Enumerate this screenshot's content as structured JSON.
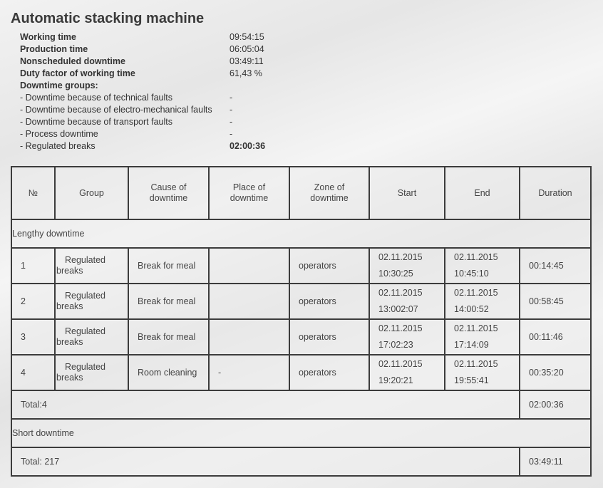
{
  "title": "Automatic stacking machine",
  "summary": {
    "working_time_label": "Working time",
    "working_time_value": "09:54:15",
    "production_time_label": "Production time",
    "production_time_value": "06:05:04",
    "nonscheduled_label": "Nonscheduled downtime",
    "nonscheduled_value": "03:49:11",
    "duty_factor_label": "Duty factor of working time",
    "duty_factor_value": "61,43 %",
    "groups_label": "Downtime groups:",
    "groups": [
      {
        "label": "- Downtime because of technical faults",
        "value": "-"
      },
      {
        "label": "- Downtime because of electro-mechanical faults",
        "value": "-"
      },
      {
        "label": "- Downtime because of transport faults",
        "value": "-"
      },
      {
        "label": "- Process downtime",
        "value": "-"
      },
      {
        "label": "- Regulated breaks",
        "value": "02:00:36"
      }
    ]
  },
  "table": {
    "headers": [
      "№",
      "Group",
      "Cause of downtime",
      "Place of downtime",
      "Zone of downtime",
      "Start",
      "End",
      "Duration"
    ],
    "lengthy_label": "Lengthy downtime",
    "rows": [
      {
        "no": "1",
        "group_line1": "Regulated",
        "group_line2": "breaks",
        "cause": "Break for meal",
        "place": "",
        "zone": "operators",
        "start_date": "02.11.2015",
        "start_time": "10:30:25",
        "end_date": "02.11.2015",
        "end_time": "10:45:10",
        "duration": "00:14:45"
      },
      {
        "no": "2",
        "group_line1": "Regulated",
        "group_line2": "breaks",
        "cause": "Break for meal",
        "place": "",
        "zone": "operators",
        "start_date": "02.11.2015",
        "start_time": "13:002:07",
        "end_date": "02.11.2015",
        "end_time": "14:00:52",
        "duration": "00:58:45"
      },
      {
        "no": "3",
        "group_line1": "Regulated",
        "group_line2": "breaks",
        "cause": "Break for meal",
        "place": "",
        "zone": "operators",
        "start_date": "02.11.2015",
        "start_time": "17:02:23",
        "end_date": "02.11.2015",
        "end_time": "17:14:09",
        "duration": "00:11:46"
      },
      {
        "no": "4",
        "group_line1": "Regulated",
        "group_line2": "breaks",
        "cause": "Room cleaning",
        "place": "-",
        "zone": "operators",
        "start_date": "02.11.2015",
        "start_time": "19:20:21",
        "end_date": "02.11.2015",
        "end_time": "19:55:41",
        "duration": "00:35:20"
      }
    ],
    "lengthy_total_label": "Total:4",
    "lengthy_total_value": "02:00:36",
    "short_label": "Short downtime",
    "short_total_label": "Total: 217",
    "short_total_value": "03:49:11"
  }
}
